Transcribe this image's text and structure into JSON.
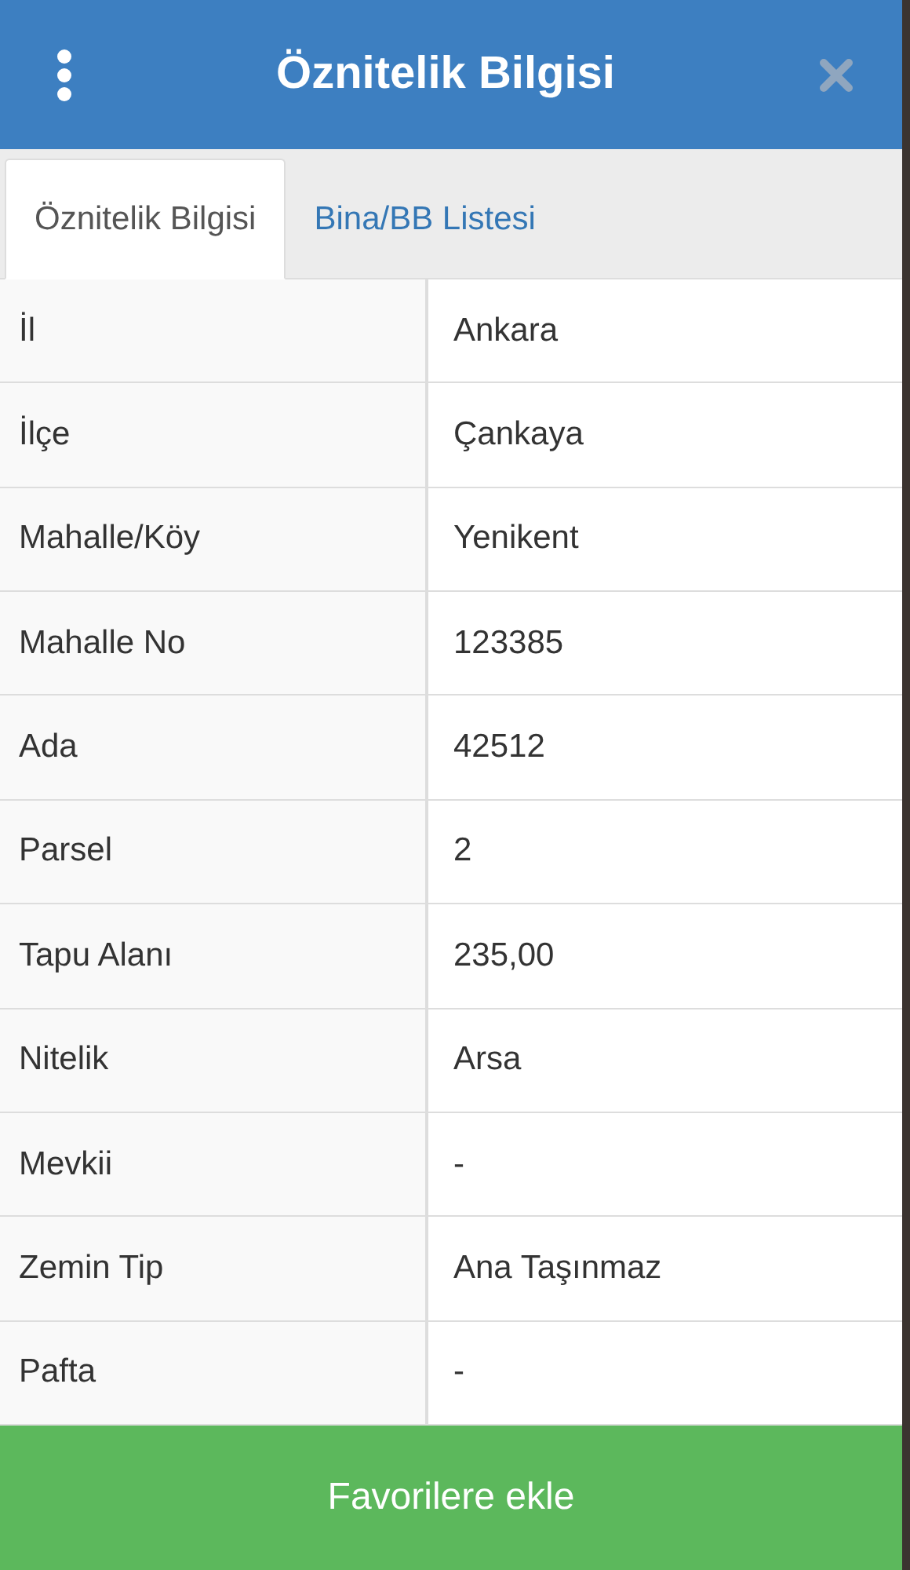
{
  "header": {
    "title": "Öznitelik Bilgisi"
  },
  "tabs": [
    {
      "label": "Öznitelik Bilgisi",
      "selected": true
    },
    {
      "label": "Bina/BB Listesi",
      "selected": false
    }
  ],
  "table": {
    "rows": [
      {
        "label": "İl",
        "value": "Ankara"
      },
      {
        "label": "İlçe",
        "value": "Çankaya"
      },
      {
        "label": "Mahalle/Köy",
        "value": "Yenikent"
      },
      {
        "label": "Mahalle No",
        "value": "123385"
      },
      {
        "label": "Ada",
        "value": "42512"
      },
      {
        "label": "Parsel",
        "value": "2"
      },
      {
        "label": "Tapu Alanı",
        "value": "235,00"
      },
      {
        "label": "Nitelik",
        "value": "Arsa"
      },
      {
        "label": "Mevkii",
        "value": "-"
      },
      {
        "label": "Zemin Tip",
        "value": "Ana Taşınmaz"
      },
      {
        "label": "Pafta",
        "value": "-"
      }
    ]
  },
  "footer_button": "Favorilere ekle"
}
